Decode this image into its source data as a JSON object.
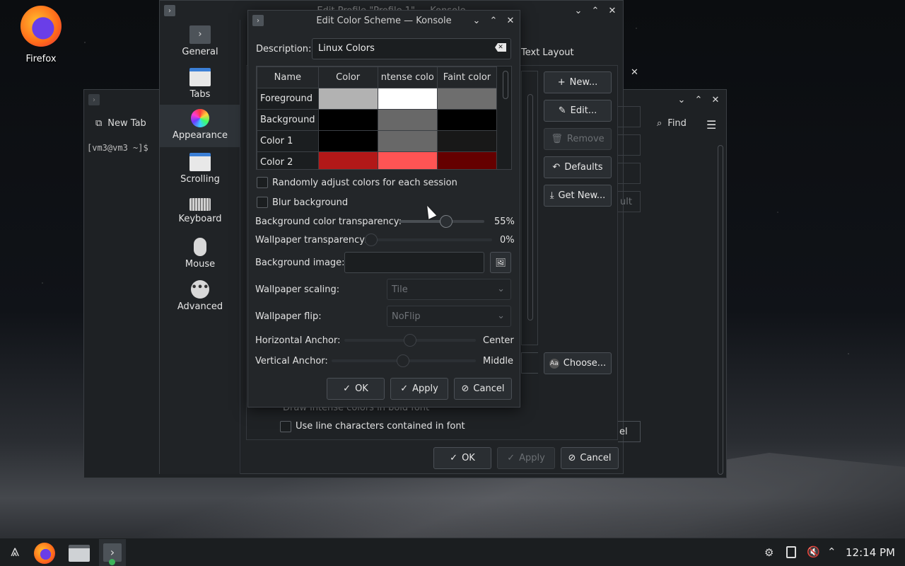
{
  "desktop": {
    "firefox_label": "Firefox"
  },
  "back_terminal": {
    "new_tab": "New Tab",
    "prompt": "[vm3@vm3 ~]$",
    "find": "Find"
  },
  "profile_window": {
    "title": "Edit Profile \"Profile 1\" — Konsole",
    "tab_text_layout": "Text Layout",
    "sidebar": [
      {
        "label": "General",
        "icon": "terminal-icon"
      },
      {
        "label": "Tabs",
        "icon": "tabs-icon"
      },
      {
        "label": "Appearance",
        "icon": "color-wheel-icon"
      },
      {
        "label": "Scrolling",
        "icon": "scroll-icon"
      },
      {
        "label": "Keyboard",
        "icon": "keyboard-icon"
      },
      {
        "label": "Mouse",
        "icon": "mouse-icon"
      },
      {
        "label": "Advanced",
        "icon": "more-icon"
      }
    ],
    "scheme_buttons": {
      "new": "New...",
      "edit": "Edit...",
      "remove": "Remove",
      "defaults": "Defaults",
      "get_new": "Get New...",
      "choose": "Choose..."
    },
    "partial_default": "ult",
    "partial_cancel": "el",
    "draw_intense": "Draw intense colors in bold font",
    "line_chars": "Use line characters contained in font",
    "ok": "OK",
    "apply": "Apply",
    "cancel": "Cancel"
  },
  "dialog": {
    "title": "Edit Color Scheme — Konsole",
    "description_label": "Description:",
    "description_value": "Linux Colors",
    "table": {
      "headers": [
        "Name",
        "Color",
        "ntense colo",
        "Faint color"
      ],
      "rows": [
        {
          "name": "Foreground",
          "color": "#b2b2b2",
          "intense": "#ffffff",
          "faint": "#6e6e6e"
        },
        {
          "name": "Background",
          "color": "#000000",
          "intense": "#686868",
          "faint": "#000000"
        },
        {
          "name": "Color 1",
          "color": "#000000",
          "intense": "#686868",
          "faint": "#181818"
        },
        {
          "name": "Color 2",
          "color": "#b21818",
          "intense": "#ff5454",
          "faint": "#650000"
        }
      ]
    },
    "random_label": "Randomly adjust colors for each session",
    "blur_label": "Blur background",
    "bg_transparency_label": "Background color transparency:",
    "bg_transparency_value": "55%",
    "bg_transparency_fraction": 0.55,
    "wp_transparency_label": "Wallpaper transparency:",
    "wp_transparency_value": "0%",
    "bg_image_label": "Background image:",
    "wp_scaling_label": "Wallpaper scaling:",
    "wp_scaling_value": "Tile",
    "wp_flip_label": "Wallpaper flip:",
    "wp_flip_value": "NoFlip",
    "h_anchor_label": "Horizontal Anchor:",
    "h_anchor_value": "Center",
    "v_anchor_label": "Vertical Anchor:",
    "v_anchor_value": "Middle",
    "ok": "OK",
    "apply": "Apply",
    "cancel": "Cancel"
  },
  "taskbar": {
    "clock": "12:14 PM"
  }
}
